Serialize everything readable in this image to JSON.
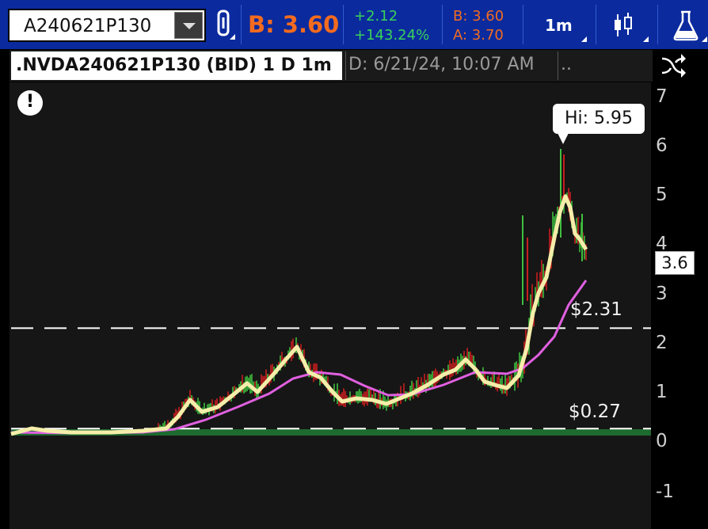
{
  "toolbar": {
    "symbol": "A240621P130",
    "bid_price": "B: 3.60",
    "change": "+2.12",
    "change_pct": "+143.24%",
    "bid": "B: 3.60",
    "ask": "A: 3.70",
    "interval": "1m",
    "icons": [
      "dropdown-caret-icon",
      "link-icon",
      "candlestick-icon",
      "flask-icon"
    ]
  },
  "chart_header": {
    "title": ".NVDA240621P130 (BID) 1 D 1m",
    "date": "D: 6/21/24, 10:07 AM",
    "more": ".."
  },
  "chart": {
    "y_axis_labels": [
      "7",
      "6",
      "5",
      "4",
      "3",
      "2",
      "1",
      "0",
      "-1"
    ],
    "last_price_tag": "3.6",
    "high_label": "Hi: 5.95",
    "levels": [
      {
        "label": "$2.31",
        "value": 2.31
      },
      {
        "label": "$0.27",
        "value": 0.27
      }
    ],
    "colors": {
      "up": "#3fbf3f",
      "down": "#c81e1e",
      "fast_ma": "#f5eeaa",
      "slow_ma": "#e060e0",
      "volume_band": "#1d6b2f"
    }
  }
}
